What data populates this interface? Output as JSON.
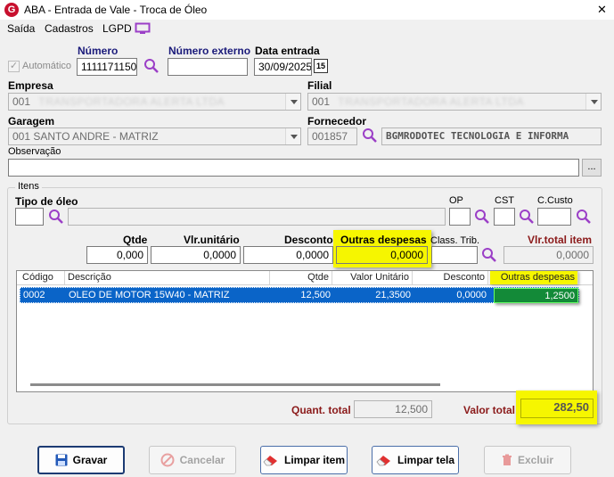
{
  "window": {
    "title": "ABA - Entrada de Vale - Troca de Óleo",
    "close_symbol": "✕"
  },
  "menu": {
    "items": [
      "Saída",
      "Cadastros",
      "LGPD"
    ]
  },
  "header": {
    "automatico_label": "Automático",
    "numero_label": "Número",
    "numero_value": "1111171150",
    "numero_externo_label": "Número externo",
    "numero_externo_value": "",
    "data_entrada_label": "Data entrada",
    "data_entrada_value": "30/09/2025",
    "calendar_text": "15"
  },
  "empresa": {
    "label": "Empresa",
    "code": "001",
    "name_redacted": "TRANSPORTADORA ALERTA LTDA"
  },
  "filial": {
    "label": "Filial",
    "code": "001",
    "name_redacted": "TRANSPORTADORA ALERTA LTDA"
  },
  "garagem": {
    "label": "Garagem",
    "value": "001 SANTO ANDRE - MATRIZ"
  },
  "fornecedor": {
    "label": "Fornecedor",
    "code": "001857",
    "name": "BGMRODOTEC TECNOLOGIA E INFORMA"
  },
  "observacao": {
    "label": "Observação",
    "value": "",
    "button": "..."
  },
  "itens": {
    "group_label": "Itens",
    "tipo_oleo_label": "Tipo de óleo",
    "op_label": "OP",
    "cst_label": "CST",
    "ccusto_label": "C.Custo",
    "qtde_label": "Qtde",
    "qtde_value": "0,000",
    "vlr_unitario_label": "Vlr.unitário",
    "vlr_unitario_value": "0,0000",
    "desconto_label": "Desconto",
    "desconto_value": "0,0000",
    "outras_despesas_label": "Outras despesas",
    "outras_despesas_value": "0,0000",
    "class_trib_label": "Class. Trib.",
    "vlr_total_item_label": "Vlr.total item",
    "vlr_total_item_value": "0,0000"
  },
  "grid": {
    "columns": [
      "Código",
      "Descrição",
      "Qtde",
      "Valor Unitário",
      "Desconto",
      "Outras despesas"
    ],
    "rows": [
      {
        "codigo": "0002",
        "descricao": "OLEO DE MOTOR 15W40 - MATRIZ",
        "qtde": "12,500",
        "valor_unitario": "21,3500",
        "desconto": "0,0000",
        "outras_despesas": "1,2500"
      }
    ]
  },
  "totals": {
    "quant_total_label": "Quant. total",
    "quant_total_value": "12,500",
    "valor_total_label": "Valor total",
    "valor_total_value": "282,50"
  },
  "buttons": {
    "gravar": "Gravar",
    "cancelar": "Cancelar",
    "limpar_item": "Limpar item",
    "limpar_tela": "Limpar tela",
    "excluir": "Excluir"
  },
  "colors": {
    "selection": "#0a64c8",
    "highlight": "#f6f600",
    "label_navy": "#1a1a7a",
    "label_maroon": "#8b1a1a",
    "search_icon": "#9b3fc7"
  }
}
